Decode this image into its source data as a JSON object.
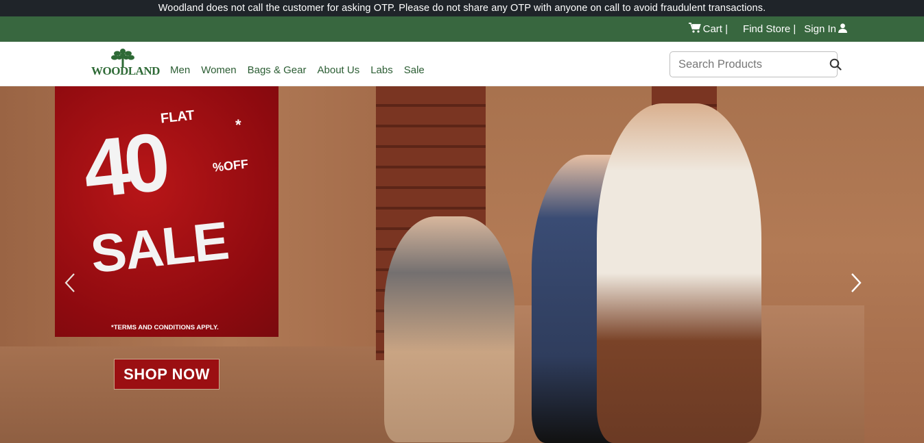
{
  "notice": {
    "text": "Woodland does not call the customer for asking OTP. Please do not share any OTP with anyone on call to avoid fraudulent transactions."
  },
  "topbar": {
    "cart_label": "Cart |",
    "find_store_label": "Find Store |",
    "sign_in_label": "Sign In"
  },
  "header": {
    "logo_text": "WOODLAND",
    "menu": [
      {
        "label": "Men"
      },
      {
        "label": "Women"
      },
      {
        "label": "Bags & Gear"
      },
      {
        "label": "About Us"
      },
      {
        "label": "Labs"
      },
      {
        "label": "Sale"
      }
    ],
    "search": {
      "placeholder": "Search Products",
      "value": ""
    }
  },
  "hero": {
    "promo": {
      "flat": "FLAT",
      "number": "40",
      "star": "*",
      "off": "%OFF",
      "sale": "SALE",
      "terms": "*TERMS AND CONDITIONS APPLY."
    },
    "cta_label": "SHOP NOW"
  },
  "colors": {
    "notice_bg": "#1f2429",
    "topbar_bg": "#38673f",
    "brand_green": "#2e6a36",
    "promo_red": "#9b0f12"
  },
  "icons": {
    "cart": "cart-icon",
    "user": "user-icon",
    "search": "search-icon",
    "prev": "chevron-left-icon",
    "next": "chevron-right-icon",
    "logo": "tree-icon"
  }
}
